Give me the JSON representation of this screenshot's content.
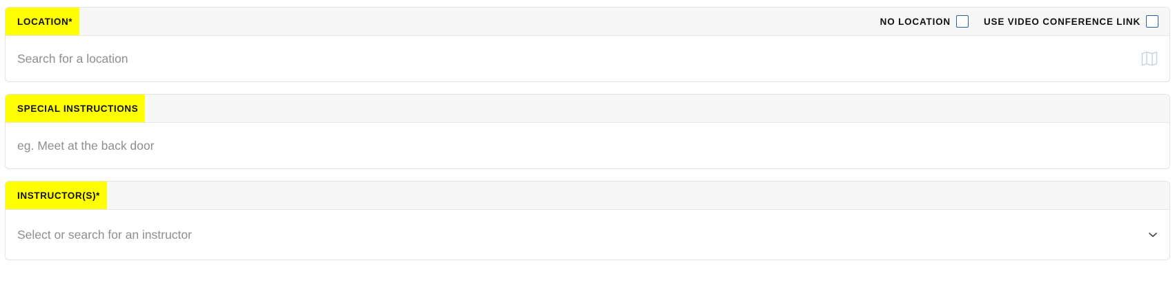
{
  "location": {
    "label": "LOCATION*",
    "options": [
      {
        "label": "NO LOCATION",
        "checked": false
      },
      {
        "label": "USE VIDEO CONFERENCE LINK",
        "checked": false
      }
    ],
    "placeholder": "Search for a location",
    "icon": "map-icon"
  },
  "special_instructions": {
    "label": "SPECIAL INSTRUCTIONS",
    "placeholder": "eg. Meet at the back door"
  },
  "instructors": {
    "label": "INSTRUCTOR(S)*",
    "placeholder": "Select or search for an instructor",
    "icon": "chevron-down-icon"
  },
  "colors": {
    "label_highlight": "#ffff00",
    "checkbox_border": "#2a5ea8",
    "placeholder_text": "#8e8e8e",
    "header_bg": "#f7f7f7"
  }
}
